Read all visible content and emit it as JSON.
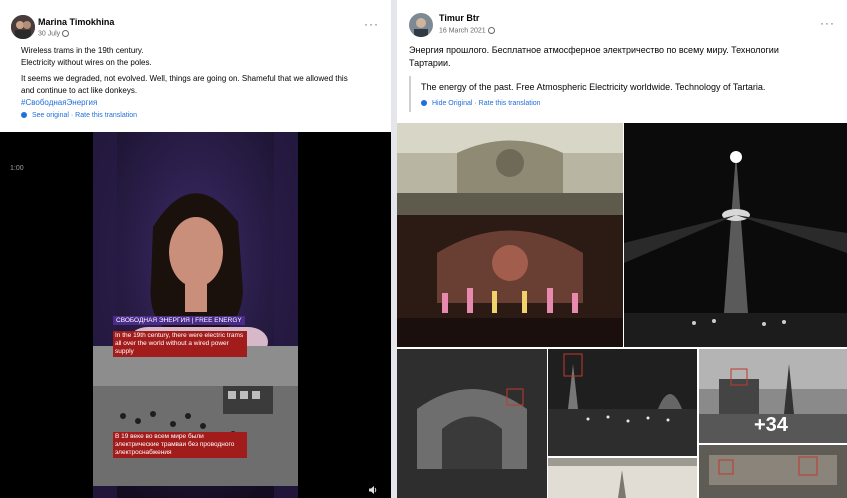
{
  "left_post": {
    "author": "Marina Timokhina",
    "date": "30 July",
    "more": "···",
    "lines": [
      "Wireless trams in the 19th century.",
      "Electricity without wires on the poles."
    ],
    "paragraph": [
      "It seems we degraded, not evolved. Well, things are going on. Shameful that we allowed this",
      "and continue to act like donkeys."
    ],
    "hashtag": "#СвободнаяЭнергия",
    "see_original": "See original",
    "rate": "Rate this translation",
    "separator": "·",
    "video": {
      "time": "1:00",
      "banner": "СВОБОДНАЯ ЭНЕРГИЯ | FREE ENERGY",
      "caption_en": "In the 19th century, there were electric trams all over the world without a wired power supply",
      "caption_ru": "В 19 веке во всем мире были электрические трамваи без проводного электроснабжения"
    }
  },
  "right_post": {
    "author": "Timur Btr",
    "date": "16 March 2021",
    "more": "···",
    "original_text": [
      "Энергия прошлого. Бесплатное атмосферное электричество по всему миру.  Технологии",
      "Тартарии."
    ],
    "translation": "The energy of the past. Free Atmospheric Electricity worldwide. Technology of Tartaria.",
    "hide_original": "Hide Original",
    "rate": "Rate this translation",
    "separator": "·",
    "more_photos": "+34"
  }
}
